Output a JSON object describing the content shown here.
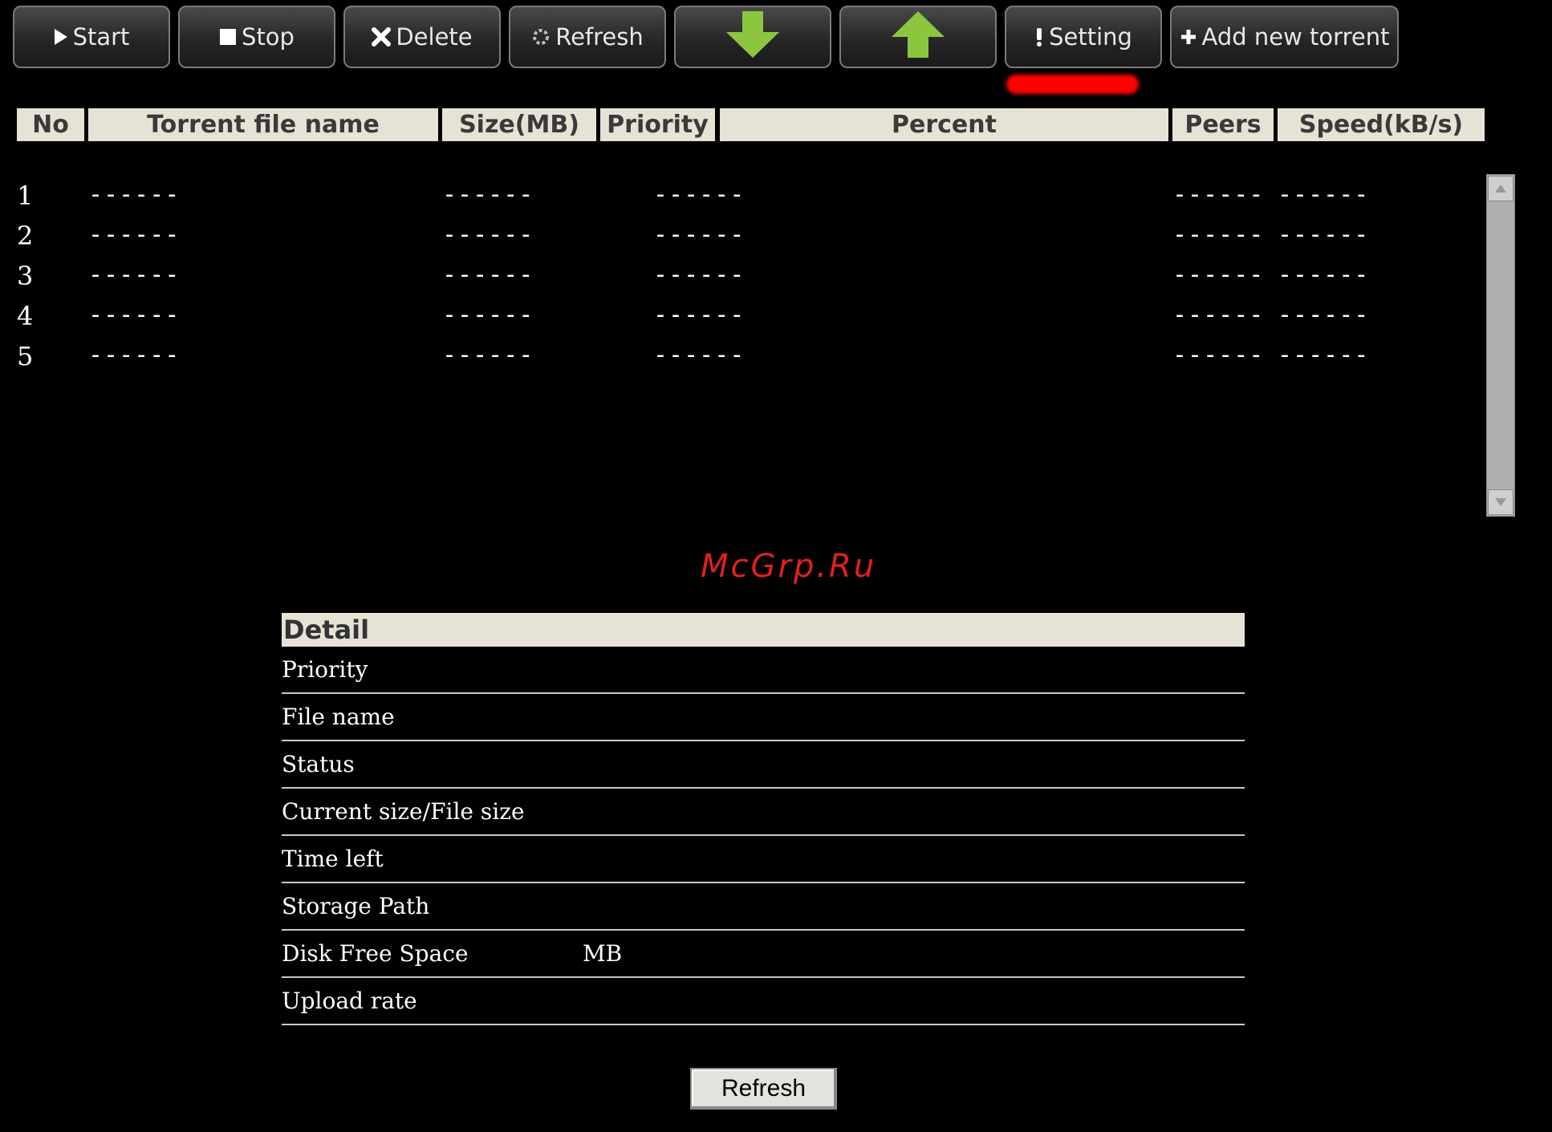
{
  "toolbar": {
    "start_label": "Start",
    "stop_label": "Stop",
    "delete_label": "Delete",
    "refresh_label": "Refresh",
    "setting_label": "Setting",
    "add_label": "Add new torrent",
    "arrow_color": "#8cc63f",
    "highlight_color": "#ff0000"
  },
  "table": {
    "headers": [
      "No",
      "Torrent file name",
      "Size(MB)",
      "Priority",
      "Percent",
      "Peers",
      "Speed(kB/s)"
    ],
    "rows": [
      {
        "no": "1",
        "name": "------",
        "size": "------",
        "priority": "------",
        "peers": "------",
        "speed": "------"
      },
      {
        "no": "2",
        "name": "------",
        "size": "------",
        "priority": "------",
        "peers": "------",
        "speed": "------"
      },
      {
        "no": "3",
        "name": "------",
        "size": "------",
        "priority": "------",
        "peers": "------",
        "speed": "------"
      },
      {
        "no": "4",
        "name": "------",
        "size": "------",
        "priority": "------",
        "peers": "------",
        "speed": "------"
      },
      {
        "no": "5",
        "name": "------",
        "size": "------",
        "priority": "------",
        "peers": "------",
        "speed": "------"
      }
    ]
  },
  "watermark": "McGrp.Ru",
  "detail": {
    "title": "Detail",
    "rows": [
      "Priority",
      "File name",
      "Status",
      "Current size/File size",
      "Time left",
      "Storage Path",
      "Disk Free Space",
      "Upload rate"
    ],
    "disk_unit": "MB"
  },
  "refresh_button": "Refresh"
}
